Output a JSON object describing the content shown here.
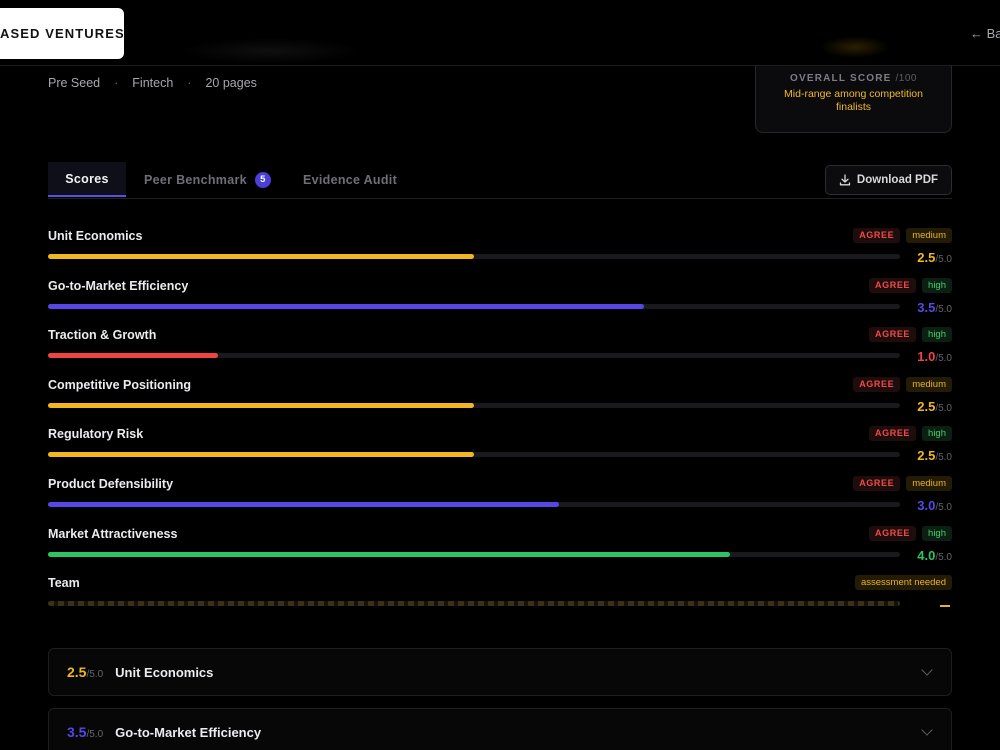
{
  "header": {
    "logo_text": "ASED VENTURES",
    "back_label": "← Ba"
  },
  "deck_meta": {
    "stage": "Pre Seed",
    "sector": "Fintech",
    "pages": "20 pages",
    "separator": "·"
  },
  "overall_score": {
    "label": "OVERALL SCORE",
    "max_label": "/100",
    "note": "Mid-range among competition finalists"
  },
  "tabs": [
    {
      "label": "Scores",
      "active": true
    },
    {
      "label": "Peer Benchmark",
      "badge": "5",
      "active": false
    },
    {
      "label": "Evidence Audit",
      "active": false
    }
  ],
  "download_label": "Download PDF",
  "scores": [
    {
      "name": "Unit Economics",
      "agree": "AGREE",
      "confidence": "medium",
      "score": 2.5,
      "score_text": "2.5",
      "max_text": "/5.0",
      "color": "#f0b71e"
    },
    {
      "name": "Go-to-Market Efficiency",
      "agree": "AGREE",
      "confidence": "high",
      "score": 3.5,
      "score_text": "3.5",
      "max_text": "/5.0",
      "color": "#5548e6"
    },
    {
      "name": "Traction & Growth",
      "agree": "AGREE",
      "confidence": "high",
      "score": 1.0,
      "score_text": "1.0",
      "max_text": "/5.0",
      "color": "#ef4444"
    },
    {
      "name": "Competitive Positioning",
      "agree": "AGREE",
      "confidence": "medium",
      "score": 2.5,
      "score_text": "2.5",
      "max_text": "/5.0",
      "color": "#f0b71e"
    },
    {
      "name": "Regulatory Risk",
      "agree": "AGREE",
      "confidence": "high",
      "score": 2.5,
      "score_text": "2.5",
      "max_text": "/5.0",
      "color": "#f0b71e"
    },
    {
      "name": "Product Defensibility",
      "agree": "AGREE",
      "confidence": "medium",
      "score": 3.0,
      "score_text": "3.0",
      "max_text": "/5.0",
      "color": "#5548e6"
    },
    {
      "name": "Market Attractiveness",
      "agree": "AGREE",
      "confidence": "high",
      "score": 4.0,
      "score_text": "4.0",
      "max_text": "/5.0",
      "color": "#2fc463"
    },
    {
      "name": "Team",
      "agree": "",
      "confidence": "assessment needed",
      "score": null,
      "score_text": "",
      "max_text": "",
      "color": "#e8b324"
    }
  ],
  "score_max": 5,
  "accordion": [
    {
      "score_text": "2.5",
      "max_text": "/5.0",
      "title": "Unit Economics",
      "color": "#f0b71e"
    },
    {
      "score_text": "3.5",
      "max_text": "/5.0",
      "title": "Go-to-Market Efficiency",
      "color": "#5548e6"
    }
  ],
  "colors": {
    "accent": "#5b4fe0",
    "warning": "#f0b92e",
    "danger": "#ef4a4a",
    "success": "#3fcf6a"
  }
}
